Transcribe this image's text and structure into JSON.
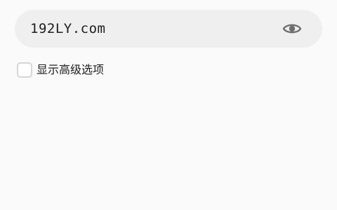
{
  "password_field": {
    "value": "192LY.com",
    "toggle_icon": "eye-icon",
    "icon_color": "#6e6e6e"
  },
  "advanced_options": {
    "label": "显示高级选项",
    "checked": false
  }
}
